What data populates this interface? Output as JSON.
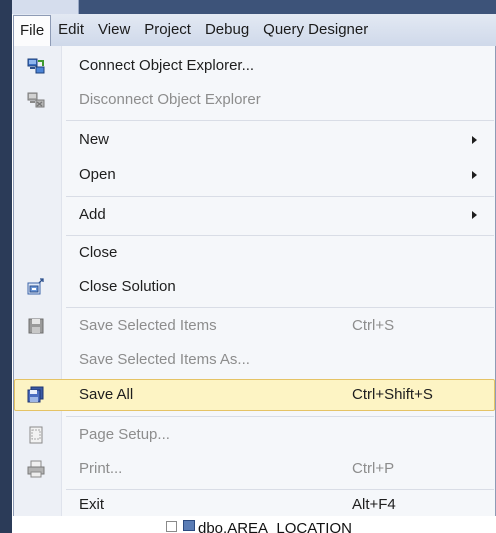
{
  "menubar": {
    "items": [
      "File",
      "Edit",
      "View",
      "Project",
      "Debug",
      "Query Designer"
    ]
  },
  "file_menu": {
    "items": [
      {
        "label": "Connect Object Explorer...",
        "icon": "connect-object-explorer-icon"
      },
      {
        "label": "Disconnect Object Explorer",
        "icon": "disconnect-object-explorer-icon",
        "disabled": true
      },
      {
        "label": "New",
        "submenu": true
      },
      {
        "label": "Open",
        "submenu": true
      },
      {
        "label": "Add",
        "submenu": true
      },
      {
        "label": "Close"
      },
      {
        "label": "Close Solution",
        "icon": "close-solution-icon"
      },
      {
        "label": "Save Selected Items",
        "shortcut": "Ctrl+S",
        "icon": "save-icon",
        "disabled": true
      },
      {
        "label": "Save Selected Items As...",
        "disabled": true
      },
      {
        "label": "Save All",
        "shortcut": "Ctrl+Shift+S",
        "icon": "save-all-icon",
        "highlighted": true
      },
      {
        "label": "Page Setup...",
        "icon": "page-setup-icon",
        "disabled": true
      },
      {
        "label": "Print...",
        "shortcut": "Ctrl+P",
        "icon": "print-icon",
        "disabled": true
      },
      {
        "label": "Exit",
        "shortcut": "Alt+F4"
      }
    ]
  },
  "background": {
    "tree_item": "dbo.AREA_LOCATION"
  },
  "colors": {
    "menubar_bg": "#d9e1ef",
    "menu_bg": "#f5f7fa",
    "highlight_bg": "#fdf4c4",
    "highlight_border": "#e5c365",
    "disabled_text": "#8d8d8d"
  }
}
